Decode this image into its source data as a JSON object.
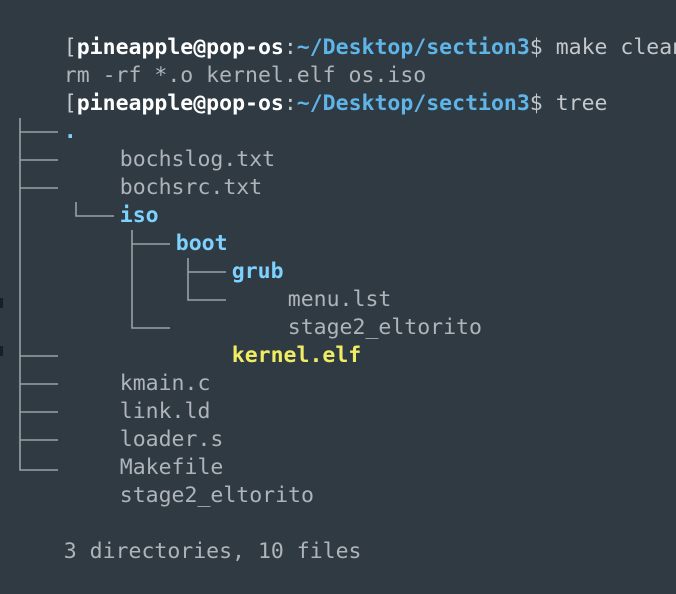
{
  "prompt": {
    "open_bracket": "[",
    "user_host": "pineapple@pop-os",
    "sep": ":",
    "cwd": "~/Desktop/section3",
    "suffix": "$ "
  },
  "commands": {
    "first": "make clean",
    "first_output": "rm -rf *.o kernel.elf os.iso",
    "second": "tree"
  },
  "tree": {
    "root": ".",
    "entries": [
      {
        "name": "bochslog.txt",
        "kind": "file"
      },
      {
        "name": "bochsrc.txt",
        "kind": "file"
      },
      {
        "name": "iso",
        "kind": "dir"
      },
      {
        "name": "boot",
        "kind": "dir"
      },
      {
        "name": "grub",
        "kind": "dir"
      },
      {
        "name": "menu.lst",
        "kind": "file"
      },
      {
        "name": "stage2_eltorito",
        "kind": "file"
      },
      {
        "name": "kernel.elf",
        "kind": "exe"
      },
      {
        "name": "kmain.c",
        "kind": "file"
      },
      {
        "name": "link.ld",
        "kind": "file"
      },
      {
        "name": "loader.s",
        "kind": "file"
      },
      {
        "name": "Makefile",
        "kind": "file"
      },
      {
        "name": "stage2_eltorito",
        "kind": "file"
      }
    ],
    "summary": "3 directories, 10 files"
  },
  "colors": {
    "background": "#2f3a42",
    "path": "#5fb4e8",
    "directory": "#7ed2ff",
    "executable": "#f1ed63",
    "text": "#c3c8cc"
  }
}
